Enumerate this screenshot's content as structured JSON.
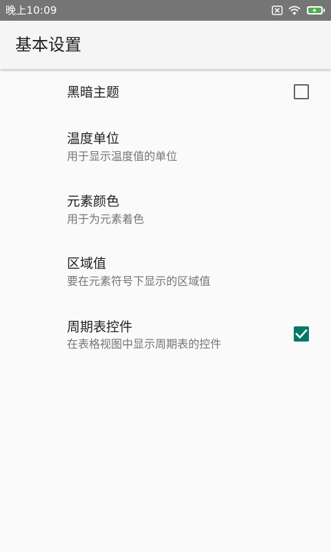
{
  "status_bar": {
    "time": "晚上10:09",
    "icons": [
      "sim-x-icon",
      "wifi-icon",
      "battery-charging-icon"
    ],
    "battery_color": "#4caf50"
  },
  "app_bar": {
    "title": "基本设置"
  },
  "settings": {
    "dark_theme": {
      "title": "黑暗主题",
      "checked": false
    },
    "temperature_unit": {
      "title": "温度单位",
      "summary": "用于显示温度值的单位"
    },
    "element_color": {
      "title": "元素颜色",
      "summary": "用于为元素着色"
    },
    "area_value": {
      "title": "区域值",
      "summary": "要在元素符号下显示的区域值"
    },
    "periodic_table_widget": {
      "title": "周期表控件",
      "summary": "在表格视图中显示周期表的控件",
      "checked": true
    }
  },
  "colors": {
    "accent": "#00796b",
    "status_bar": "#757575",
    "background": "#fafafa"
  }
}
